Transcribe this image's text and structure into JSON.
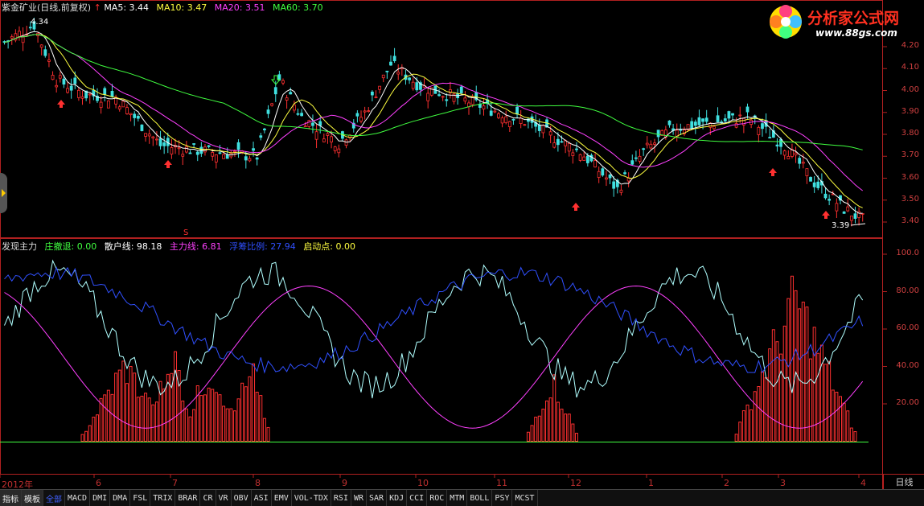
{
  "header": {
    "title": "紫金矿业(日线,前复权)",
    "ma": [
      {
        "label": "MA5: 3.44",
        "color": "#ffffff"
      },
      {
        "label": "MA10: 3.47",
        "color": "#ffff40"
      },
      {
        "label": "MA20: 3.51",
        "color": "#ff40ff"
      },
      {
        "label": "MA60: 3.70",
        "color": "#40ff40"
      }
    ]
  },
  "indicator": {
    "name": "发现主力",
    "items": [
      {
        "label": "庄撤退: 0.00",
        "color": "#40ff40"
      },
      {
        "label": "散户线: 98.18",
        "color": "#ffffff"
      },
      {
        "label": "主力线: 6.81",
        "color": "#ff40ff"
      },
      {
        "label": "浮筹比例: 27.94",
        "color": "#3050ff"
      },
      {
        "label": "启动点: 0.00",
        "color": "#ffff40"
      }
    ]
  },
  "price_axis": [
    "4.20",
    "4.10",
    "4.00",
    "3.90",
    "3.80",
    "3.70",
    "3.60",
    "3.50",
    "3.40"
  ],
  "indicator_axis": [
    "100.0",
    "80.00",
    "60.00",
    "40.00",
    "20.00"
  ],
  "annotations": {
    "high": "4.34",
    "low": "3.39",
    "signal": "S"
  },
  "months": [
    {
      "label": "2012年"
    },
    {
      "label": "6"
    },
    {
      "label": "7"
    },
    {
      "label": "8"
    },
    {
      "label": "9"
    },
    {
      "label": "10"
    },
    {
      "label": "11"
    },
    {
      "label": "12"
    },
    {
      "label": "1"
    },
    {
      "label": "2"
    },
    {
      "label": "3"
    },
    {
      "label": "4"
    }
  ],
  "period": "日线",
  "logo": {
    "title": "分析家公式网",
    "url": "www.88gs.com"
  },
  "tabs": [
    {
      "label": "指标",
      "style": "boxed"
    },
    {
      "label": "模板",
      "style": "boxed"
    },
    {
      "label": "全部",
      "style": "active"
    },
    {
      "label": "MACD"
    },
    {
      "label": "DMI"
    },
    {
      "label": "DMA"
    },
    {
      "label": "FSL"
    },
    {
      "label": "TRIX"
    },
    {
      "label": "BRAR"
    },
    {
      "label": "CR"
    },
    {
      "label": "VR"
    },
    {
      "label": "OBV"
    },
    {
      "label": "ASI"
    },
    {
      "label": "EMV"
    },
    {
      "label": "VOL-TDX"
    },
    {
      "label": "RSI"
    },
    {
      "label": "WR"
    },
    {
      "label": "SAR"
    },
    {
      "label": "KDJ"
    },
    {
      "label": "CCI"
    },
    {
      "label": "ROC"
    },
    {
      "label": "MTM"
    },
    {
      "label": "BOLL"
    },
    {
      "label": "PSY"
    },
    {
      "label": "MCST"
    }
  ],
  "colors": {
    "up": "#ff3030",
    "down": "#40e0e0",
    "grid": "#b02020",
    "ma5": "#ffffff",
    "ma10": "#ffff40",
    "ma20": "#ff40ff",
    "ma60": "#40ff40"
  }
}
